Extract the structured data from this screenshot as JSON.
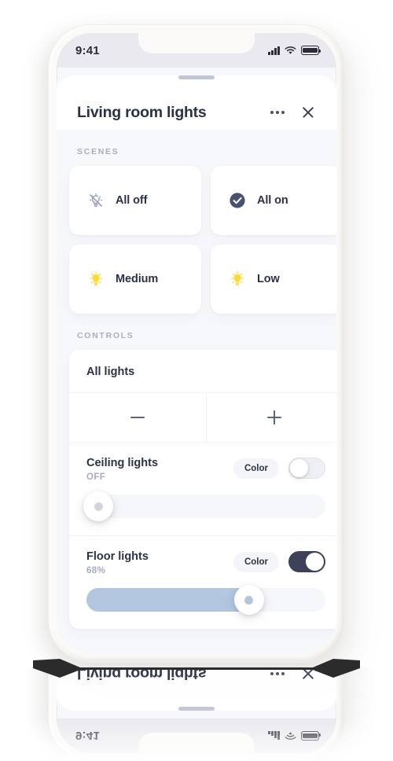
{
  "status_bar": {
    "time": "9:41",
    "icons": [
      "signal-icon",
      "wifi-icon",
      "battery-icon"
    ]
  },
  "sheet": {
    "title": "Living room lights",
    "more_icon": "more-horizontal-icon",
    "close_icon": "close-icon",
    "grabber": "drag-handle"
  },
  "scenes": {
    "label": "SCENES",
    "items": [
      {
        "label": "All off",
        "icon": "bulb-off-icon",
        "icon_color": "#9ca0bc"
      },
      {
        "label": "All on",
        "icon": "check-circle-icon",
        "icon_color": "#4a5070"
      },
      {
        "label": "Medium",
        "icon": "bulb-on-icon",
        "icon_color": "#ffd935"
      },
      {
        "label": "Low",
        "icon": "bulb-on-icon",
        "icon_color": "#ffd935"
      }
    ]
  },
  "controls": {
    "label": "CONTROLS",
    "all_lights": {
      "title": "All lights",
      "decrease_label": "minus-icon",
      "increase_label": "plus-icon"
    },
    "lights": [
      {
        "name": "Ceiling lights",
        "state": "OFF",
        "color_button": "Color",
        "toggle_on": false,
        "brightness": 0
      },
      {
        "name": "Floor lights",
        "state": "68%",
        "color_button": "Color",
        "toggle_on": true,
        "brightness": 68
      }
    ]
  },
  "colors": {
    "accent_dark": "#3d4259",
    "slider_fill": "#b3c6e0",
    "bulb_yellow": "#ffd935",
    "text_primary": "#2c3147",
    "text_muted": "#a6abc4",
    "sheet_bg": "#f7f8fb",
    "card_bg": "#ffffff"
  }
}
